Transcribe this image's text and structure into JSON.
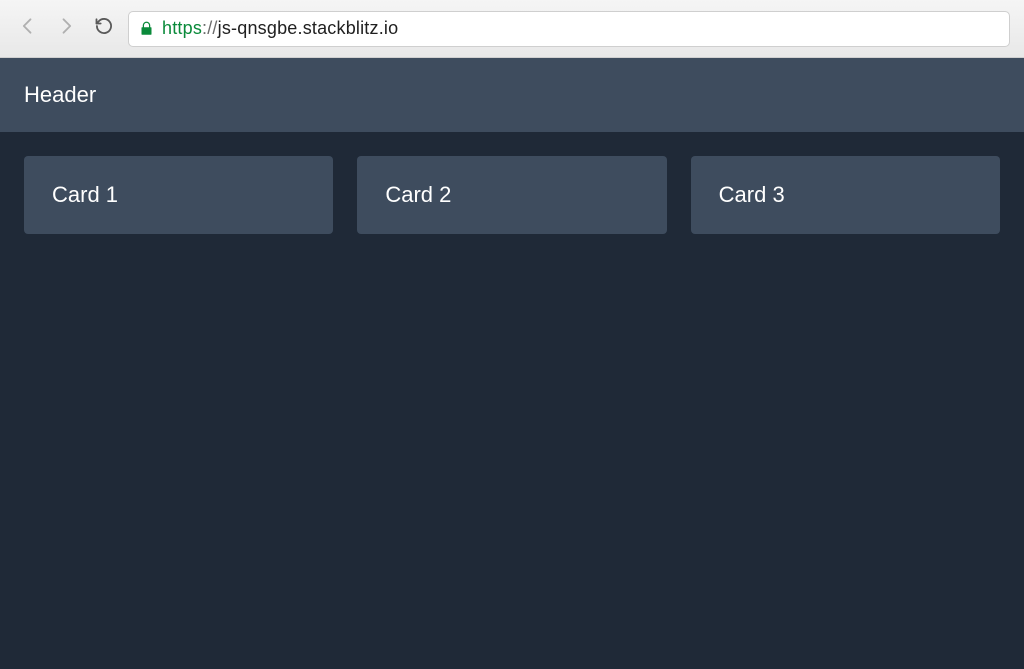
{
  "browser": {
    "url_protocol": "https",
    "url_sep": "://",
    "url_host": "js-qnsgbe.stackblitz.io"
  },
  "page": {
    "header_title": "Header",
    "cards": [
      {
        "label": "Card 1"
      },
      {
        "label": "Card 2"
      },
      {
        "label": "Card 3"
      }
    ]
  }
}
